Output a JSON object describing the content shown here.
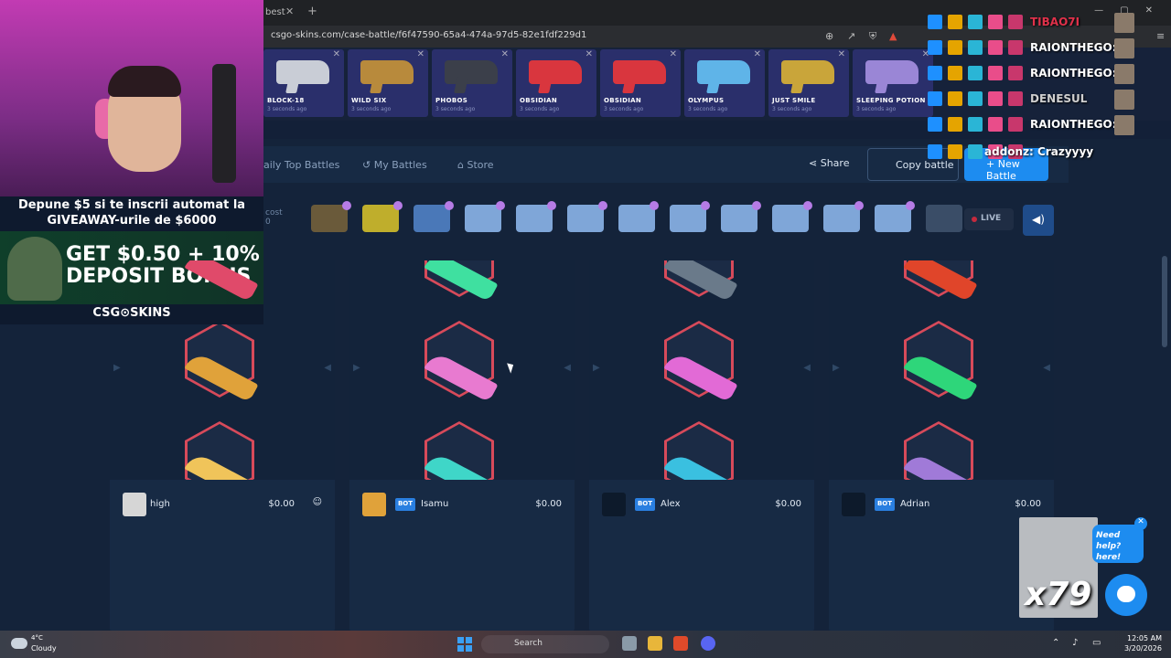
{
  "browser": {
    "tab_title": "best",
    "tab_close": "✕",
    "new_tab": "+",
    "url": "csgo-skins.com/case-battle/f6f47590-65a4-474a-97d5-82e1fdf229d1",
    "win_min": "—",
    "win_max": "▢",
    "win_close": "✕"
  },
  "drops": [
    {
      "name": "BLOCK-18",
      "ago": "3 seconds ago",
      "color": "#c9cdd6"
    },
    {
      "name": "WILD SIX",
      "ago": "3 seconds ago",
      "color": "#b88a3c"
    },
    {
      "name": "PHOBOS",
      "ago": "3 seconds ago",
      "color": "#3b3f4a"
    },
    {
      "name": "OBSIDIAN",
      "ago": "3 seconds ago",
      "color": "#d9363e"
    },
    {
      "name": "OBSIDIAN",
      "ago": "3 seconds ago",
      "color": "#d9363e"
    },
    {
      "name": "OLYMPUS",
      "ago": "3 seconds ago",
      "color": "#5fb4e8"
    },
    {
      "name": "JUST SMILE",
      "ago": "3 seconds ago",
      "color": "#c9a53a"
    },
    {
      "name": "SLEEPING POTION",
      "ago": "3 seconds ago",
      "color": "#9a86d6"
    }
  ],
  "nav": {
    "daily_top": "aily Top Battles",
    "my_battles": "My Battles",
    "store": "Store",
    "share": "Share",
    "copy_battle": "Copy battle",
    "new_battle": "+ New Battle",
    "cost_fragment": "cost",
    "cost_value": "0",
    "live": "LIVE"
  },
  "cases": [
    {
      "color": "#6a5a3a"
    },
    {
      "color": "#bfae2c"
    },
    {
      "color": "#4a78b8"
    },
    {
      "color": "#7fa6d8"
    },
    {
      "color": "#7fa6d8"
    },
    {
      "color": "#7fa6d8"
    },
    {
      "color": "#7fa6d8"
    },
    {
      "color": "#7fa6d8"
    },
    {
      "color": "#7fa6d8"
    },
    {
      "color": "#7fa6d8"
    },
    {
      "color": "#7fa6d8"
    },
    {
      "color": "#7fa6d8"
    },
    {
      "color": "#3a4d67"
    }
  ],
  "players": [
    {
      "name": "high",
      "value": "$0.00",
      "bot": false,
      "avatar_color": "#d6d6d6"
    },
    {
      "name": "Isamu",
      "value": "$0.00",
      "bot": true,
      "bot_label": "BOT",
      "avatar_color": "#e0a23a"
    },
    {
      "name": "Alex",
      "value": "$0.00",
      "bot": true,
      "bot_label": "BOT",
      "avatar_color": "#0d1a2b"
    },
    {
      "name": "Adrian",
      "value": "$0.00",
      "bot": true,
      "bot_label": "BOT",
      "avatar_color": "#0d1a2b"
    }
  ],
  "reels": [
    {
      "knives": [
        "#e04a6a",
        "#e0a23a",
        "#f0c45a"
      ]
    },
    {
      "knives": [
        "#3fe0a0",
        "#e87ad0",
        "#3fd6c8"
      ]
    },
    {
      "knives": [
        "#6a7a8a",
        "#e26ad6",
        "#3ac0e0"
      ]
    },
    {
      "knives": [
        "#e0452a",
        "#2ed67a",
        "#a07ad8"
      ]
    }
  ],
  "promo": {
    "line1": "Depune $5 si te inscrii automat la",
    "line2": "GIVEAWAY-urile de $6000",
    "big1": "GET $0.50 + 10%",
    "big2": "DEPOSIT BONUS",
    "brand": "CSG⊙SKINS"
  },
  "chat": [
    {
      "user": "TIBAO7I",
      "color": "#e0314a"
    },
    {
      "user": "RAIONTHEGO:",
      "color": "#ffffff"
    },
    {
      "user": "RAIONTHEGO:",
      "color": "#ffffff"
    },
    {
      "user": "DENESUL",
      "color": "#cfcfcf"
    },
    {
      "user": "RAIONTHEGO:",
      "color": "#ffffff"
    },
    {
      "user": "addonz: Crazyyyy",
      "color": "#ffffff"
    }
  ],
  "help": {
    "bubble": "Need help? here!",
    "close": "✕",
    "multiplier": "x79"
  },
  "taskbar": {
    "temp": "4°C",
    "weather": "Cloudy",
    "search": "Search",
    "time": "12:05 AM",
    "date": "3/20/2026"
  }
}
